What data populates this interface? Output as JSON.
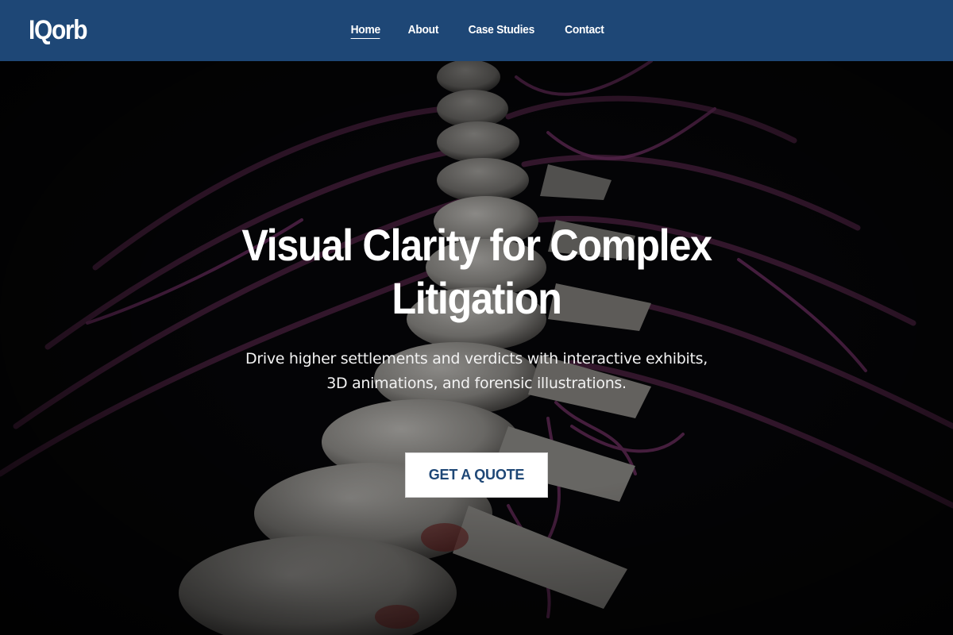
{
  "brand": {
    "logo_text": "IQorb"
  },
  "nav": {
    "items": [
      {
        "label": "Home",
        "active": true
      },
      {
        "label": "About",
        "active": false
      },
      {
        "label": "Case Studies",
        "active": false
      },
      {
        "label": "Contact",
        "active": false
      }
    ]
  },
  "hero": {
    "headline": "Visual Clarity for Complex Litigation",
    "subheadline_line1": "Drive higher settlements and verdicts with interactive exhibits,",
    "subheadline_line2": "3D animations, and forensic illustrations.",
    "cta_label": "GET A QUOTE",
    "background": "3d-spine-illustration"
  },
  "colors": {
    "navbar": "#1e4776",
    "cta_text": "#1e4776",
    "cta_background": "#ffffff",
    "hero_background": "#050507",
    "nerve_purple": "#5a2a4e"
  }
}
